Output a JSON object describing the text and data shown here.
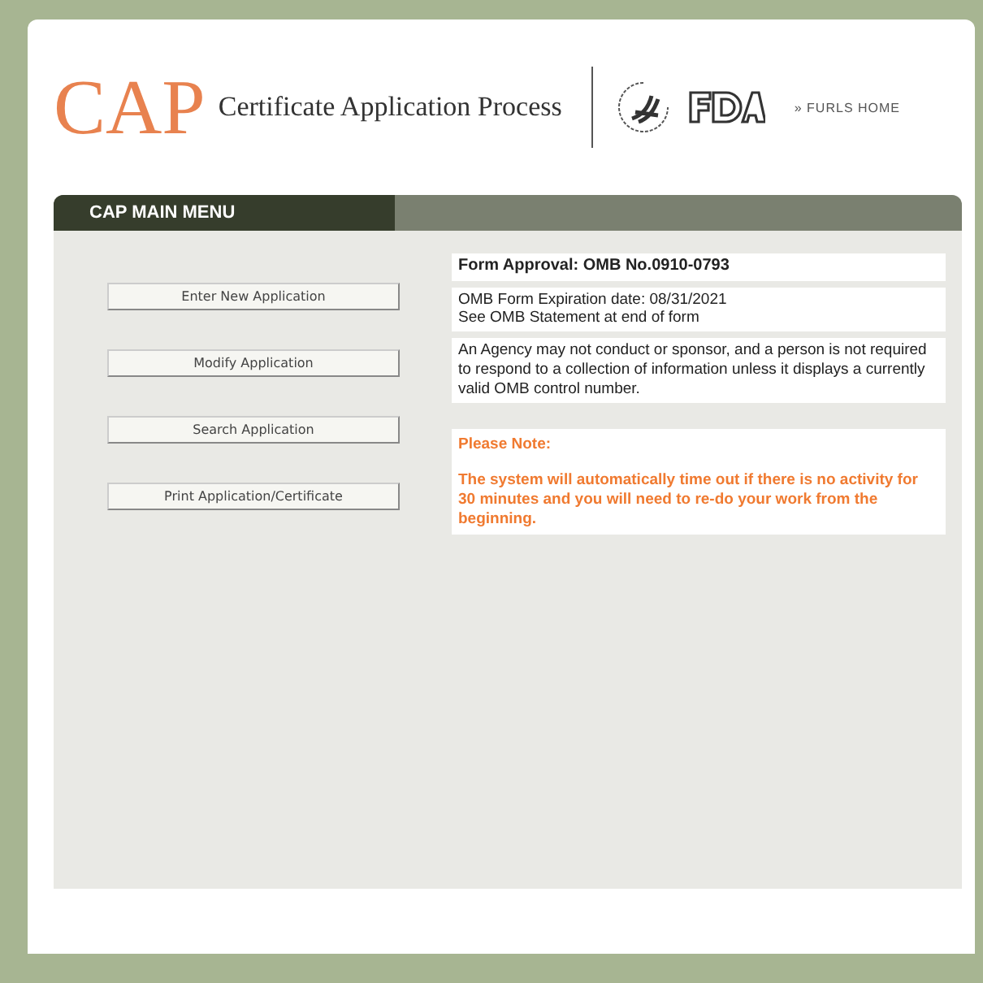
{
  "header": {
    "logo": "CAP",
    "title": "Certificate Application Process",
    "home_link": "» FURLS HOME"
  },
  "menu": {
    "title": "CAP MAIN MENU",
    "buttons": [
      "Enter New Application",
      "Modify Application",
      "Search Application",
      "Print Application/Certificate"
    ]
  },
  "info": {
    "approval": "Form Approval: OMB No.0910-0793",
    "expiration": [
      "OMB Form Expiration date: 08/31/2021",
      "See OMB Statement at end of form"
    ],
    "statement": "An Agency may not conduct or sponsor, and a person is not required to respond to a collection of information unless it displays a currently valid OMB control number.",
    "note_title": "Please Note:",
    "note": "The system will automatically time out if there is no activity for 30 minutes and you will need to re-do your work from the beginning."
  }
}
